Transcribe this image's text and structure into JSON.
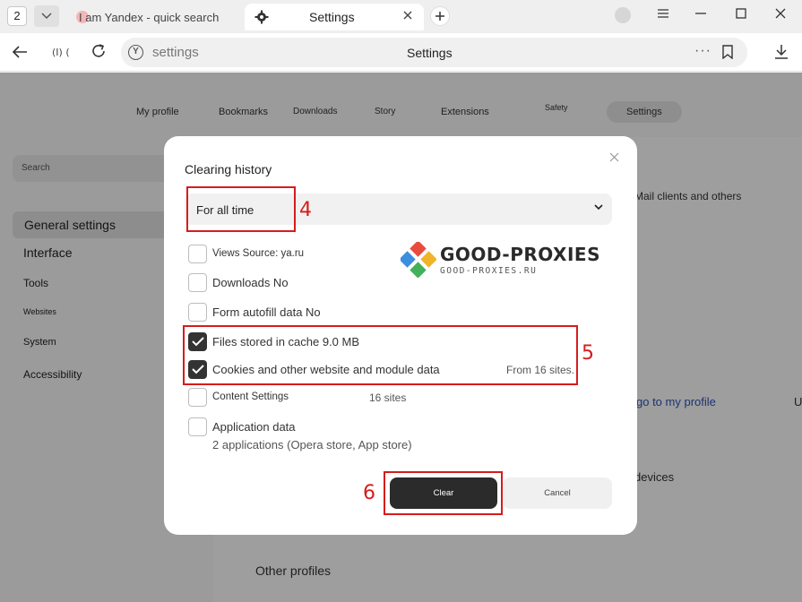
{
  "tabstrip": {
    "tab_count": "2",
    "inactive_tab_title": "I am Yandex - quick search",
    "active_tab_title": "Settings"
  },
  "addressbar": {
    "audio_indicator": "(I) (",
    "url": "settings",
    "page_title": "Settings",
    "more": "···"
  },
  "settings_tabs": [
    "My profile",
    "Bookmarks",
    "Downloads",
    "Story",
    "Extensions",
    "Safety",
    "Settings"
  ],
  "sidebar": {
    "search_placeholder": "Search",
    "items": [
      "General settings",
      "Interface",
      "Tools",
      "Websites",
      "System",
      "Accessibility"
    ]
  },
  "background": {
    "mail_clients": "Mail clients and others",
    "goto_profile": "go to my profile",
    "u_cut": "U",
    "devices": "devices",
    "other_profiles": "Other profiles"
  },
  "dialog": {
    "title": "Clearing history",
    "period_value": "For all time",
    "options": [
      {
        "label": "Views Source: ya.ru",
        "checked": false
      },
      {
        "label": "Downloads No",
        "checked": false
      },
      {
        "label": "Form autofill data No",
        "checked": false
      },
      {
        "label": "Files stored in cache 9.0 MB",
        "checked": true
      },
      {
        "label": "Cookies and other website and module data",
        "checked": true,
        "right": "From 16 sites."
      },
      {
        "label": "Content Settings",
        "checked": false,
        "right": "16 sites"
      },
      {
        "label": "Application data",
        "checked": false,
        "sub": "2 applications (Opera store, App store)"
      }
    ],
    "clear_label": "Clear",
    "cancel_label": "Cancel"
  },
  "annotations": [
    "4",
    "5",
    "6"
  ],
  "watermark": {
    "brand": "GOOD-PROXIES",
    "site": "GOOD-PROXIES.RU"
  },
  "colors": {
    "annotation_red": "#d61c1c",
    "clear_button": "#2b2b2b",
    "checkbox_checked": "#333333"
  }
}
